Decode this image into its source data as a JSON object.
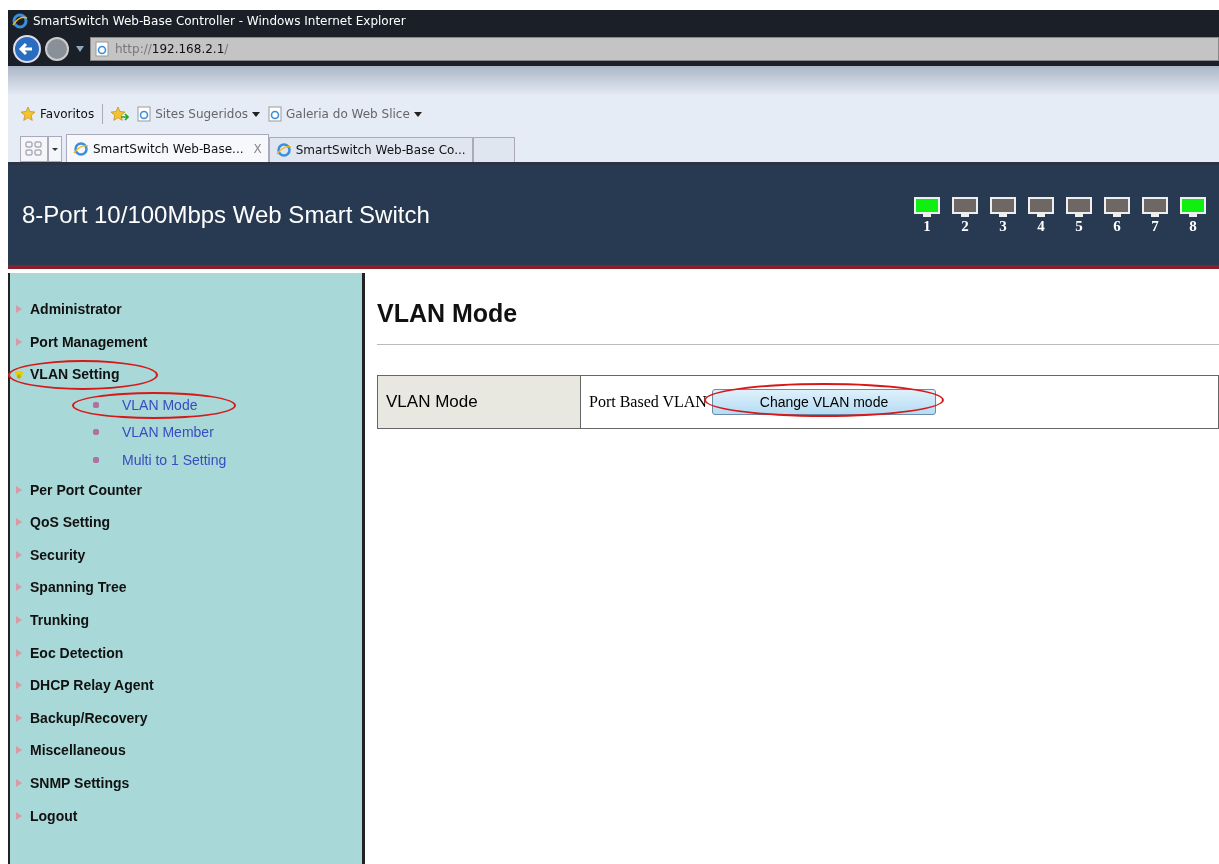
{
  "window": {
    "title": "SmartSwitch Web-Base Controller - Windows Internet Explorer"
  },
  "address_bar": {
    "scheme": "http://",
    "host": "192.168.2.1",
    "path": "/"
  },
  "favorites_bar": [
    {
      "label": "Favoritos",
      "kind": "star"
    },
    {
      "label": "Sites Sugeridos",
      "kind": "dropdown"
    },
    {
      "label": "Galeria do Web Slice",
      "kind": "dropdown"
    }
  ],
  "tabs": [
    {
      "label": "SmartSwitch Web-Base...",
      "selected": true,
      "close": "X"
    },
    {
      "label": "SmartSwitch Web-Base Co...",
      "selected": false
    }
  ],
  "header": {
    "title": "8-Port 10/100Mbps Web Smart Switch",
    "ports": [
      {
        "label": "1",
        "link": true
      },
      {
        "label": "2",
        "link": false
      },
      {
        "label": "3",
        "link": false
      },
      {
        "label": "4",
        "link": false
      },
      {
        "label": "5",
        "link": false
      },
      {
        "label": "6",
        "link": false
      },
      {
        "label": "7",
        "link": false
      },
      {
        "label": "8",
        "link": true
      }
    ]
  },
  "sidebar": {
    "items": [
      {
        "label": "Administrator",
        "expanded": false,
        "circled": false
      },
      {
        "label": "Port Management",
        "expanded": false,
        "circled": false
      },
      {
        "label": "VLAN Setting",
        "expanded": true,
        "circled": true,
        "children": [
          {
            "label": "VLAN Mode",
            "circled": true
          },
          {
            "label": "VLAN Member",
            "circled": false
          },
          {
            "label": "Multi to 1 Setting",
            "circled": false
          }
        ]
      },
      {
        "label": "Per Port Counter",
        "expanded": false,
        "circled": false
      },
      {
        "label": "QoS Setting",
        "expanded": false,
        "circled": false
      },
      {
        "label": "Security",
        "expanded": false,
        "circled": false
      },
      {
        "label": "Spanning Tree",
        "expanded": false,
        "circled": false
      },
      {
        "label": "Trunking",
        "expanded": false,
        "circled": false
      },
      {
        "label": "Eoc Detection",
        "expanded": false,
        "circled": false
      },
      {
        "label": "DHCP Relay Agent",
        "expanded": false,
        "circled": false
      },
      {
        "label": "Backup/Recovery",
        "expanded": false,
        "circled": false
      },
      {
        "label": "Miscellaneous",
        "expanded": false,
        "circled": false
      },
      {
        "label": "SNMP Settings",
        "expanded": false,
        "circled": false
      },
      {
        "label": "Logout",
        "expanded": false,
        "circled": false
      }
    ]
  },
  "content": {
    "heading": "VLAN Mode",
    "rows": [
      {
        "label": "VLAN Mode",
        "value": "Port Based VLAN",
        "button": "Change VLAN mode",
        "circled": true
      }
    ]
  }
}
